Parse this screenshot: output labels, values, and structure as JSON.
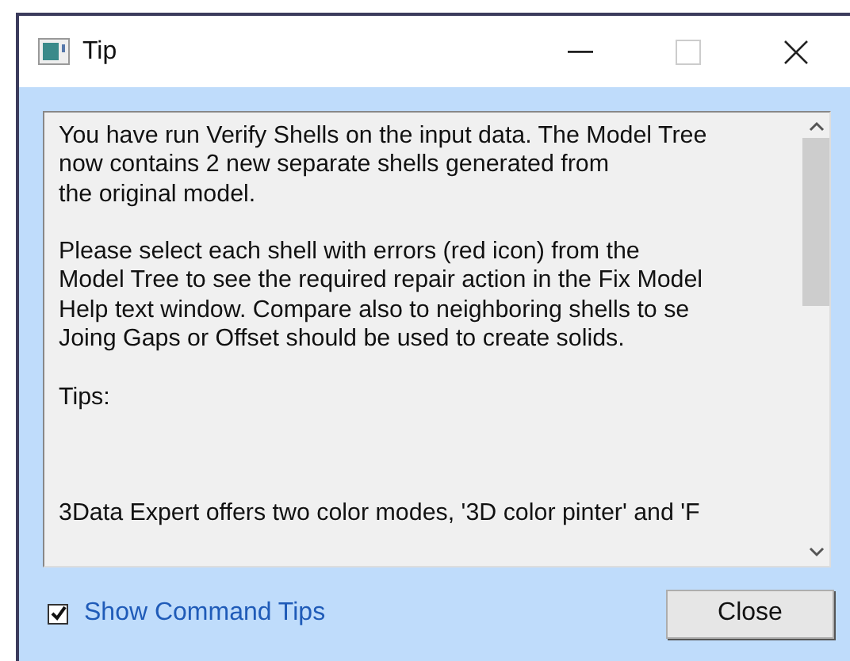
{
  "window": {
    "title": "Tip"
  },
  "message": {
    "paragraphs": [
      [
        "You have run Verify Shells on the input data. The Model Tree",
        "now contains 2 new separate shells generated from",
        "the original model."
      ],
      [
        "Please select each shell with errors (red icon) from the",
        "Model Tree to see the required repair action in the Fix Model",
        "Help text window. Compare also to neighboring shells to se",
        "Joing Gaps or Offset should be used to create solids."
      ],
      [
        "Tips:"
      ],
      [
        "3Data Expert offers two color modes, '3D color pinter' and 'F"
      ]
    ]
  },
  "show_tips": {
    "label": "Show Command Tips",
    "checked": true
  },
  "buttons": [
    "Close"
  ]
}
